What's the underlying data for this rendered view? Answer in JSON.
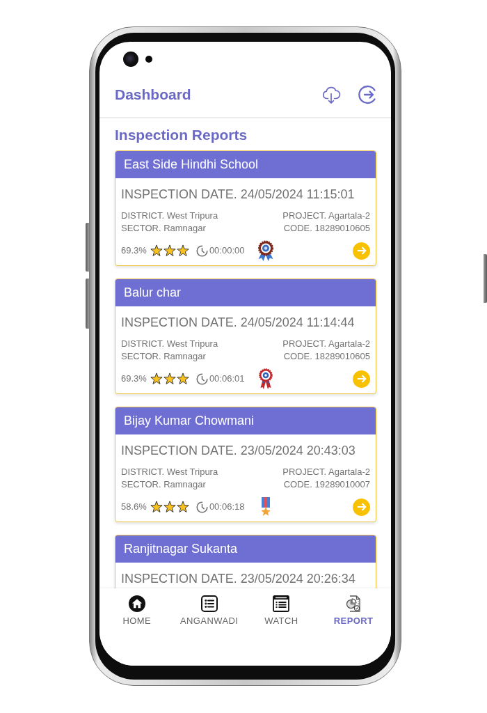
{
  "header": {
    "title": "Dashboard"
  },
  "section_title": "Inspection Reports",
  "reports": [
    {
      "title": "East Side Hindhi School",
      "inspection_date": "INSPECTION DATE. 24/05/2024 11:15:01",
      "district": "DISTRICT. West Tripura",
      "project": "PROJECT. Agartala-2",
      "sector": "SECTOR. Ramnagar",
      "code": "CODE. 18289010605",
      "score": "69.3%",
      "stars": 3,
      "duration": "00:00:00",
      "kind": "rosette"
    },
    {
      "title": "Balur char",
      "inspection_date": "INSPECTION DATE. 24/05/2024 11:14:44",
      "district": "DISTRICT. West Tripura",
      "project": "PROJECT. Agartala-2",
      "sector": "SECTOR. Ramnagar",
      "code": "CODE. 18289010605",
      "score": "69.3%",
      "stars": 3,
      "duration": "00:06:01",
      "kind": "cockade"
    },
    {
      "title": "Bijay Kumar Chowmani",
      "inspection_date": "INSPECTION DATE. 23/05/2024 20:43:03",
      "district": "DISTRICT. West Tripura",
      "project": "PROJECT. Agartala-2",
      "sector": "SECTOR. Ramnagar",
      "code": "CODE. 19289010007",
      "score": "58.6%",
      "stars": 3,
      "duration": "00:06:18",
      "kind": "medal"
    },
    {
      "title": "Ranjitnagar Sukanta",
      "inspection_date": "INSPECTION DATE. 23/05/2024 20:26:34"
    }
  ],
  "bottom_nav": [
    {
      "label": "HOME",
      "kind": "home",
      "selected": false
    },
    {
      "label": "ANGANWADI",
      "kind": "list",
      "selected": false
    },
    {
      "label": "WATCH",
      "kind": "watch",
      "selected": false
    },
    {
      "label": "REPORT",
      "kind": "report",
      "selected": true
    }
  ]
}
